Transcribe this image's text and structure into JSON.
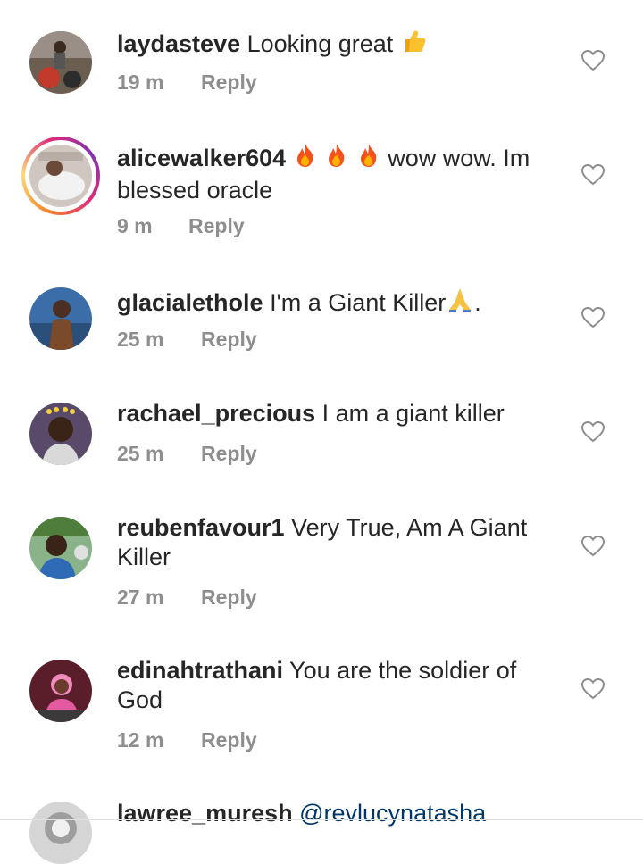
{
  "comments": [
    {
      "username": "laydasteve",
      "text": "Looking great",
      "emoji_after": "thumbs-up",
      "time": "19 m",
      "reply": "Reply"
    },
    {
      "username": "alicewalker604",
      "text_prefix_emoji": "fire x3",
      "text": "wow wow. Im blessed oracle",
      "time": "9 m",
      "reply": "Reply",
      "has_story": true
    },
    {
      "username": "glacialethole",
      "text": "I'm a Giant Killer",
      "emoji_after": "folded-hands",
      "text_suffix": ".",
      "time": "25 m",
      "reply": "Reply"
    },
    {
      "username": "rachael_precious",
      "text": "I am a giant killer",
      "time": "25 m",
      "reply": "Reply"
    },
    {
      "username": "reubenfavour1",
      "text": "Very True, Am A Giant Killer",
      "time": "27 m",
      "reply": "Reply"
    },
    {
      "username": "edinahtrathani",
      "text": "You are the soldier of God",
      "time": "12 m",
      "reply": "Reply"
    },
    {
      "username": "lawree_muresh",
      "text": "@revlucynatasha"
    }
  ],
  "colors": {
    "text": "#262626",
    "meta": "#8e8e8e",
    "mention": "#00376b",
    "background": "#ffffff"
  }
}
